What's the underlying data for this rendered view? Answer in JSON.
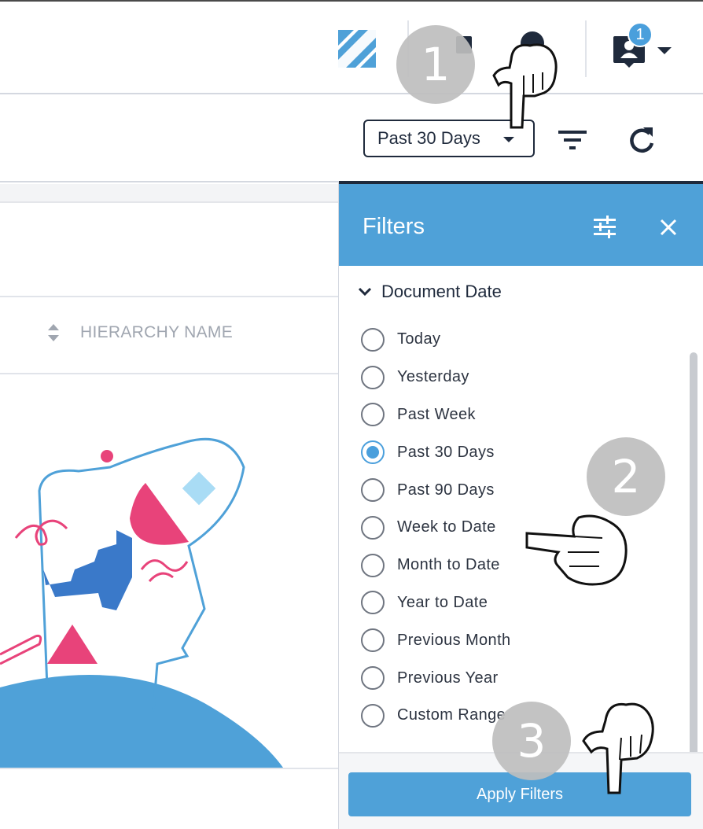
{
  "topbar": {
    "notification_count": "1",
    "accent_color": "#4a9fdc"
  },
  "toolbar": {
    "date_range_value": "Past 30 Days"
  },
  "table": {
    "column_header": "HIERARCHY NAME"
  },
  "filters_panel": {
    "title": "Filters",
    "header_color": "#4fa1d8",
    "section_title": "Document Date",
    "options": [
      {
        "label": "Today",
        "selected": false
      },
      {
        "label": "Yesterday",
        "selected": false
      },
      {
        "label": "Past Week",
        "selected": false
      },
      {
        "label": "Past 30 Days",
        "selected": true
      },
      {
        "label": "Past 90 Days",
        "selected": false
      },
      {
        "label": "Week to Date",
        "selected": false
      },
      {
        "label": "Month to Date",
        "selected": false
      },
      {
        "label": "Year to Date",
        "selected": false
      },
      {
        "label": "Previous Month",
        "selected": false
      },
      {
        "label": "Previous Year",
        "selected": false
      },
      {
        "label": "Custom Range",
        "selected": false
      }
    ],
    "apply_label": "Apply Filters"
  },
  "steps": [
    {
      "number": "1"
    },
    {
      "number": "2"
    },
    {
      "number": "3"
    }
  ]
}
